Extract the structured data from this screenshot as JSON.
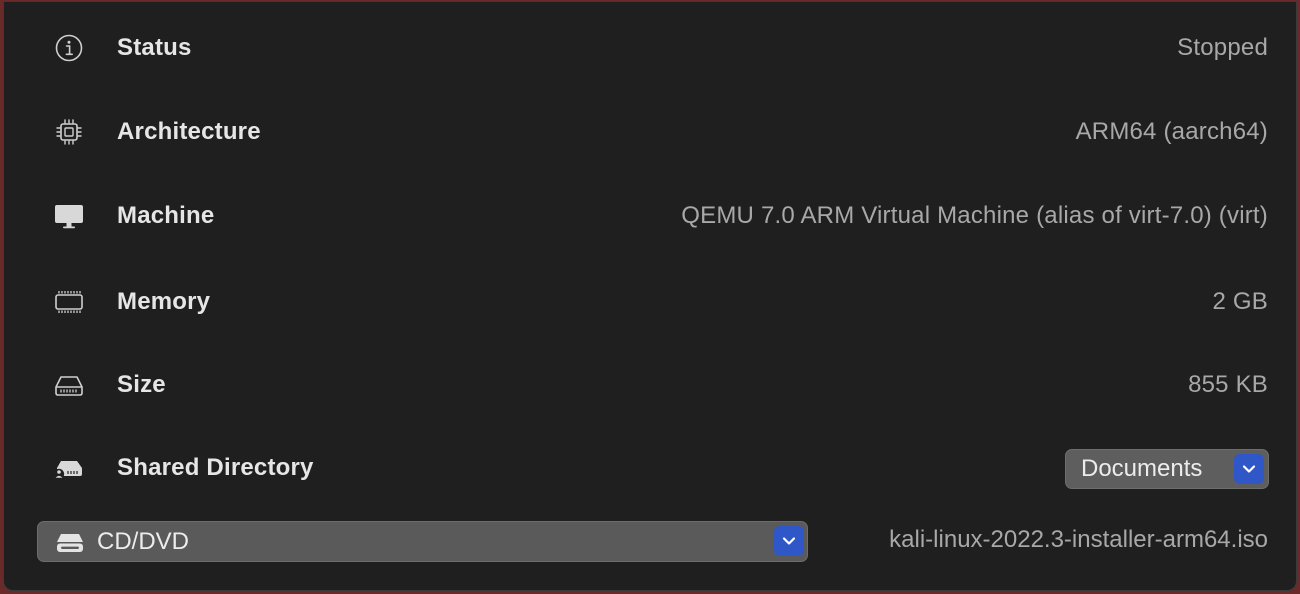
{
  "details": {
    "status": {
      "label": "Status",
      "value": "Stopped",
      "icon": "info-circle-icon"
    },
    "architecture": {
      "label": "Architecture",
      "value": "ARM64 (aarch64)",
      "icon": "cpu-chip-icon"
    },
    "machine": {
      "label": "Machine",
      "value": "QEMU 7.0 ARM Virtual Machine (alias of virt-7.0) (virt)",
      "icon": "display-icon"
    },
    "memory": {
      "label": "Memory",
      "value": "2 GB",
      "icon": "memory-module-icon"
    },
    "size": {
      "label": "Size",
      "value": "855 KB",
      "icon": "internal-drive-icon"
    },
    "shared_directory": {
      "label": "Shared Directory",
      "selected": "Documents",
      "icon": "shared-drive-icon"
    }
  },
  "drive": {
    "type_selected": "CD/DVD",
    "image_name": "kali-linux-2022.3-installer-arm64.iso",
    "icon": "optical-drive-icon"
  },
  "colors": {
    "panel_background": "#1f1f1f",
    "accent_blue": "#2f57c7",
    "label_text": "#e6e6e6",
    "value_text": "#a8a8a8"
  }
}
